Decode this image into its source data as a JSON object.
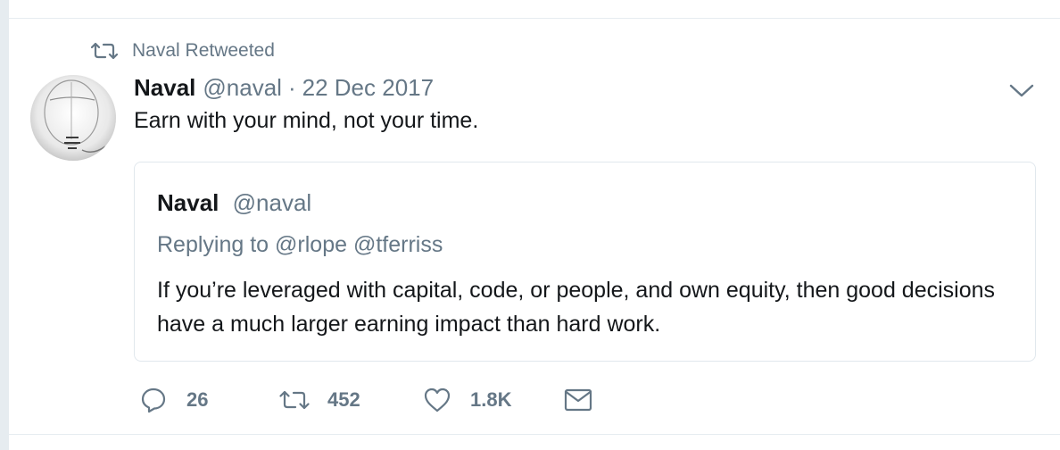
{
  "retweet_context": {
    "text": "Naval Retweeted",
    "icon": "retweet-icon"
  },
  "tweet": {
    "author_name": "Naval",
    "author_handle": "@naval",
    "separator": "·",
    "date": "22 Dec 2017",
    "text": "Earn with your mind, not your time.",
    "menu_icon": "chevron-down-icon"
  },
  "quoted_tweet": {
    "author_name": "Naval",
    "author_handle": "@naval",
    "replying_prefix": "Replying to",
    "mentions": [
      "@rlope",
      "@tferriss"
    ],
    "text": "If you’re leveraged with capital, code, or people, and own equity, then good decisions have a much larger earning impact than hard work."
  },
  "actions": {
    "reply_count": "26",
    "retweet_count": "452",
    "like_count": "1.8K",
    "icons": [
      "reply-icon",
      "retweet-icon",
      "heart-icon",
      "envelope-icon"
    ]
  },
  "colors": {
    "secondary_text": "#657786",
    "primary_text": "#14171a",
    "border": "#e1e8ed",
    "background": "#e6ecf0"
  }
}
